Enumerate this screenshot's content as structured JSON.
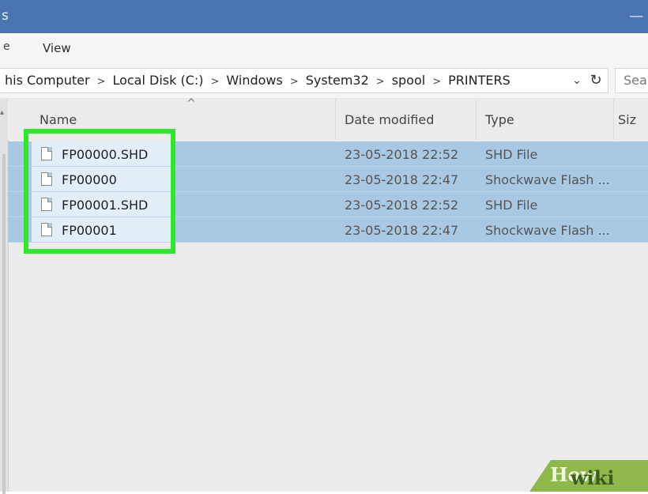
{
  "window": {
    "title_partial": "s",
    "minimize_glyph": "—"
  },
  "ribbon": {
    "file_tab_partial": "e",
    "view_tab": "View"
  },
  "address_bar": {
    "crumbs": [
      "his Computer",
      "Local Disk (C:)",
      "Windows",
      "System32",
      "spool",
      "PRINTERS"
    ],
    "separator": ">",
    "dropdown_glyph": "⌄",
    "refresh_glyph": "↻"
  },
  "search": {
    "placeholder": "Sea"
  },
  "columns": {
    "name": "Name",
    "date_modified": "Date modified",
    "type": "Type",
    "size": "Siz",
    "sort_indicator": "^"
  },
  "files": [
    {
      "name": "FP00000.SHD",
      "date": "23-05-2018 22:52",
      "type": "SHD File"
    },
    {
      "name": "FP00000",
      "date": "23-05-2018 22:47",
      "type": "Shockwave Flash ..."
    },
    {
      "name": "FP00001.SHD",
      "date": "23-05-2018 22:52",
      "type": "SHD File"
    },
    {
      "name": "FP00001",
      "date": "23-05-2018 22:47",
      "type": "Shockwave Flash ..."
    }
  ],
  "colors": {
    "titlebar": "#4a74b2",
    "selection": "#a9c8e4",
    "highlight_box": "#2ee82b",
    "watermark": "#8fb84b"
  },
  "watermark": {
    "text_a": "wiki",
    "text_b": "How"
  }
}
